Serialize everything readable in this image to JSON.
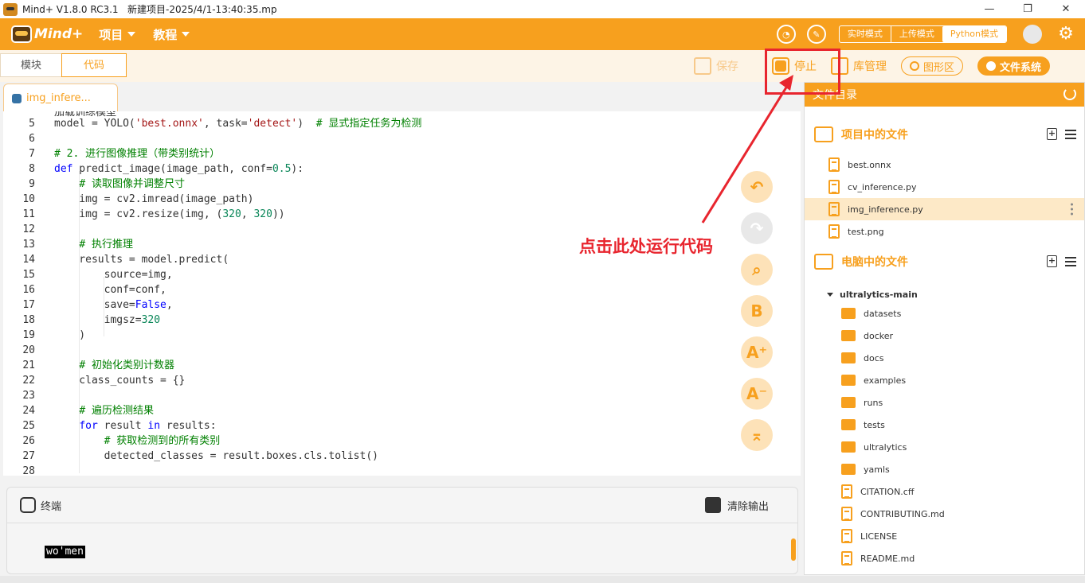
{
  "window": {
    "app_name": "Mind+ V1.8.0 RC3.1",
    "project_title": "新建项目-2025/4/1-13:40:35.mp",
    "minimize": "—",
    "restore": "❐",
    "close": "✕"
  },
  "menubar": {
    "logo_text": "Mind+",
    "menu_project": "项目",
    "menu_tutorial": "教程",
    "modes": [
      "实时模式",
      "上传模式",
      "Python模式"
    ],
    "active_mode": "Python模式",
    "accent_color": "#f7a01e"
  },
  "toolbar": {
    "tab_blocks": "模块",
    "tab_code": "代码",
    "save_label": "保存",
    "stop_label": "停止",
    "library_label": "库管理",
    "graphics_label": "图形区",
    "filesystem_label": "文件系统"
  },
  "editor": {
    "file_tab": "img_infere...",
    "partial_top": "加载训练模型",
    "lines": [
      {
        "n": "5",
        "segments": [
          {
            "t": "model = YOLO(",
            "c": ""
          },
          {
            "t": "'best.onnx'",
            "c": "st"
          },
          {
            "t": ", task=",
            "c": ""
          },
          {
            "t": "'detect'",
            "c": "st"
          },
          {
            "t": ")  ",
            "c": ""
          },
          {
            "t": "# 显式指定任务为检测",
            "c": "cm"
          }
        ]
      },
      {
        "n": "6",
        "segments": []
      },
      {
        "n": "7",
        "segments": [
          {
            "t": "# 2. 进行图像推理（带类别统计）",
            "c": "cm"
          }
        ]
      },
      {
        "n": "8",
        "segments": [
          {
            "t": "def",
            "c": "kw"
          },
          {
            "t": " predict_image(image_path, conf=",
            "c": ""
          },
          {
            "t": "0.5",
            "c": "nu"
          },
          {
            "t": "):",
            "c": ""
          }
        ]
      },
      {
        "n": "9",
        "segments": [
          {
            "t": "    ",
            "c": ""
          },
          {
            "t": "# 读取图像并调整尺寸",
            "c": "cm"
          }
        ]
      },
      {
        "n": "10",
        "segments": [
          {
            "t": "    img = cv2.imread(image_path)",
            "c": ""
          }
        ]
      },
      {
        "n": "11",
        "segments": [
          {
            "t": "    img = cv2.resize(img, (",
            "c": ""
          },
          {
            "t": "320",
            "c": "nu"
          },
          {
            "t": ", ",
            "c": ""
          },
          {
            "t": "320",
            "c": "nu"
          },
          {
            "t": "))",
            "c": ""
          }
        ]
      },
      {
        "n": "12",
        "segments": []
      },
      {
        "n": "13",
        "segments": [
          {
            "t": "    ",
            "c": ""
          },
          {
            "t": "# 执行推理",
            "c": "cm"
          }
        ]
      },
      {
        "n": "14",
        "segments": [
          {
            "t": "    results = model.predict(",
            "c": ""
          }
        ]
      },
      {
        "n": "15",
        "segments": [
          {
            "t": "        source=img,",
            "c": ""
          }
        ]
      },
      {
        "n": "16",
        "segments": [
          {
            "t": "        conf=conf,",
            "c": ""
          }
        ]
      },
      {
        "n": "17",
        "segments": [
          {
            "t": "        save=",
            "c": ""
          },
          {
            "t": "False",
            "c": "kw"
          },
          {
            "t": ",",
            "c": ""
          }
        ]
      },
      {
        "n": "18",
        "segments": [
          {
            "t": "        imgsz=",
            "c": ""
          },
          {
            "t": "320",
            "c": "nu"
          }
        ]
      },
      {
        "n": "19",
        "segments": [
          {
            "t": "    )",
            "c": ""
          }
        ]
      },
      {
        "n": "20",
        "segments": []
      },
      {
        "n": "21",
        "segments": [
          {
            "t": "    ",
            "c": ""
          },
          {
            "t": "# 初始化类别计数器",
            "c": "cm"
          }
        ]
      },
      {
        "n": "22",
        "segments": [
          {
            "t": "    class_counts = {}",
            "c": ""
          }
        ]
      },
      {
        "n": "23",
        "segments": []
      },
      {
        "n": "24",
        "segments": [
          {
            "t": "    ",
            "c": ""
          },
          {
            "t": "# 遍历检测结果",
            "c": "cm"
          }
        ]
      },
      {
        "n": "25",
        "segments": [
          {
            "t": "    ",
            "c": ""
          },
          {
            "t": "for",
            "c": "kw"
          },
          {
            "t": " result ",
            "c": ""
          },
          {
            "t": "in",
            "c": "kw"
          },
          {
            "t": " results:",
            "c": ""
          }
        ]
      },
      {
        "n": "26",
        "segments": [
          {
            "t": "        ",
            "c": ""
          },
          {
            "t": "# 获取检测到的所有类别",
            "c": "cm"
          }
        ]
      },
      {
        "n": "27",
        "segments": [
          {
            "t": "        detected_classes = result.boxes.cls.tolist()",
            "c": ""
          }
        ]
      },
      {
        "n": "28",
        "segments": []
      }
    ],
    "side_tools": [
      "undo-icon",
      "redo-icon",
      "search-icon",
      "bold-icon",
      "font-increase-icon",
      "font-decrease-icon",
      "collapse-icon"
    ]
  },
  "terminal": {
    "label": "终端",
    "clear_label": "清除输出",
    "output": "wo'men"
  },
  "file_panel": {
    "title": "文件目录",
    "project_section": "项目中的文件",
    "project_files": [
      "best.onnx",
      "cv_inference.py",
      "img_inference.py",
      "test.png"
    ],
    "selected_file": "img_inference.py",
    "computer_section": "电脑中的文件",
    "root_folder": "ultralytics-main",
    "folders": [
      "datasets",
      "docker",
      "docs",
      "examples",
      "runs",
      "tests",
      "ultralytics",
      "yamls"
    ],
    "files": [
      "CITATION.cff",
      "CONTRIBUTING.md",
      "LICENSE",
      "README.md"
    ]
  },
  "annotation": {
    "text": "点击此处运行代码",
    "color": "#e8252e"
  }
}
